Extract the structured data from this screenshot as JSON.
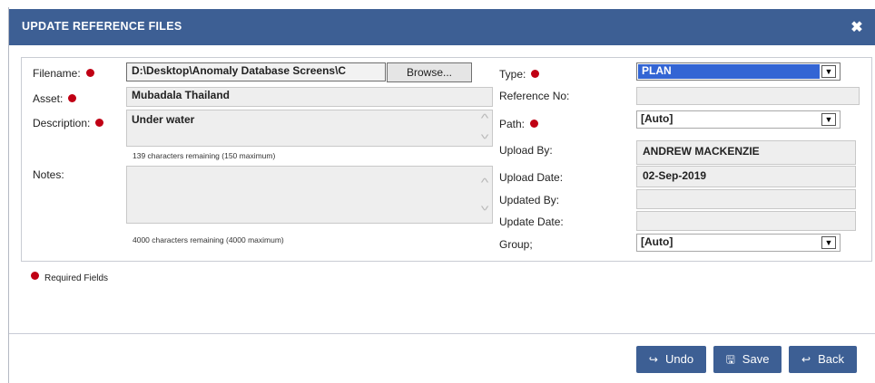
{
  "dialog": {
    "title": "UPDATE REFERENCE FILES",
    "close_icon": "close-icon",
    "close_glyph": "✖"
  },
  "form": {
    "filename": {
      "label": "Filename:",
      "value": "D:\\Desktop\\Anomaly Database Screens\\C",
      "browse_label": "Browse..."
    },
    "asset": {
      "label": "Asset:",
      "value": "Mubadala Thailand"
    },
    "description": {
      "label": "Description:",
      "value": "Under water",
      "hint": "139 characters remaining (150 maximum)"
    },
    "notes": {
      "label": "Notes:",
      "value": "",
      "hint": "4000 characters remaining (4000 maximum)"
    },
    "type": {
      "label": "Type:",
      "value": "PLAN"
    },
    "reference_no": {
      "label": "Reference No:",
      "value": ""
    },
    "path": {
      "label": "Path:",
      "value": "[Auto]"
    },
    "upload_by": {
      "label": "Upload By:",
      "value": "ANDREW MACKENZIE"
    },
    "upload_date": {
      "label": "Upload Date:",
      "value": "02-Sep-2019"
    },
    "updated_by": {
      "label": "Updated By:",
      "value": ""
    },
    "update_date": {
      "label": "Update Date:",
      "value": ""
    },
    "group": {
      "label": "Group;",
      "value": "[Auto]"
    }
  },
  "legend": {
    "required_label": "Required Fields"
  },
  "buttons": {
    "undo": {
      "label": "Undo",
      "icon": "undo-icon",
      "glyph": "↪"
    },
    "save": {
      "label": "Save",
      "icon": "save-icon",
      "glyph": "🖫"
    },
    "back": {
      "label": "Back",
      "icon": "back-icon",
      "glyph": "↩"
    }
  },
  "colors": {
    "header": "#3d5f94",
    "required_dot": "#c00014",
    "button": "#3d5f94",
    "selection": "#3365d4"
  }
}
